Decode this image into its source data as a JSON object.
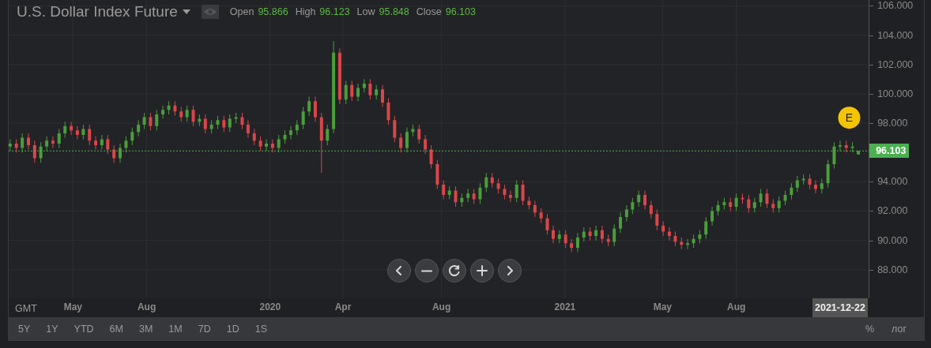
{
  "header": {
    "title": "U.S. Dollar Index Future",
    "ohlc": [
      {
        "label": "Open",
        "value": "95.866"
      },
      {
        "label": "High",
        "value": "96.123"
      },
      {
        "label": "Low",
        "value": "95.848"
      },
      {
        "label": "Close",
        "value": "96.103"
      }
    ]
  },
  "chart_data": {
    "type": "candlestick",
    "xlim": [
      2019.113,
      2022.035
    ],
    "ylim": [
      86.05,
      106.4
    ],
    "yticks": [
      {
        "value": 88,
        "label": "88.000"
      },
      {
        "value": 90,
        "label": "90.000"
      },
      {
        "value": 92,
        "label": "92.000"
      },
      {
        "value": 94,
        "label": "94.000"
      },
      {
        "value": 98,
        "label": "98.000"
      },
      {
        "value": 100,
        "label": "100.000"
      },
      {
        "value": 102,
        "label": "102.000"
      },
      {
        "value": 104,
        "label": "104.000"
      },
      {
        "value": 106,
        "label": "106.000"
      }
    ],
    "xticks": [
      {
        "value": 2019.331,
        "label": "May"
      },
      {
        "value": 2019.581,
        "label": "Aug"
      },
      {
        "value": 2020,
        "label": "2020"
      },
      {
        "value": 2020.247,
        "label": "Apr"
      },
      {
        "value": 2020.581,
        "label": "Aug"
      },
      {
        "value": 2021,
        "label": "2021"
      },
      {
        "value": 2021.331,
        "label": "May"
      },
      {
        "value": 2021.581,
        "label": "Aug"
      }
    ],
    "x": [
      2019.118,
      2019.139,
      2019.159,
      2019.18,
      2019.201,
      2019.222,
      2019.242,
      2019.263,
      2019.284,
      2019.304,
      2019.325,
      2019.346,
      2019.366,
      2019.387,
      2019.408,
      2019.429,
      2019.449,
      2019.47,
      2019.491,
      2019.511,
      2019.532,
      2019.553,
      2019.573,
      2019.594,
      2019.615,
      2019.636,
      2019.656,
      2019.677,
      2019.698,
      2019.718,
      2019.739,
      2019.76,
      2019.78,
      2019.801,
      2019.822,
      2019.843,
      2019.863,
      2019.884,
      2019.905,
      2019.925,
      2019.946,
      2019.967,
      2019.987,
      2020.008,
      2020.029,
      2020.05,
      2020.07,
      2020.091,
      2020.112,
      2020.132,
      2020.153,
      2020.174,
      2020.194,
      2020.215,
      2020.236,
      2020.257,
      2020.277,
      2020.298,
      2020.319,
      2020.339,
      2020.36,
      2020.381,
      2020.401,
      2020.422,
      2020.443,
      2020.464,
      2020.484,
      2020.505,
      2020.526,
      2020.546,
      2020.567,
      2020.588,
      2020.608,
      2020.629,
      2020.65,
      2020.671,
      2020.691,
      2020.712,
      2020.733,
      2020.753,
      2020.774,
      2020.795,
      2020.815,
      2020.836,
      2020.857,
      2020.878,
      2020.898,
      2020.919,
      2020.94,
      2020.96,
      2020.981,
      2021.002,
      2021.022,
      2021.043,
      2021.064,
      2021.085,
      2021.105,
      2021.126,
      2021.147,
      2021.167,
      2021.188,
      2021.209,
      2021.229,
      2021.25,
      2021.271,
      2021.292,
      2021.312,
      2021.333,
      2021.354,
      2021.374,
      2021.395,
      2021.416,
      2021.436,
      2021.457,
      2021.478,
      2021.499,
      2021.519,
      2021.54,
      2021.561,
      2021.581,
      2021.602,
      2021.623,
      2021.643,
      2021.664,
      2021.685,
      2021.706,
      2021.726,
      2021.747,
      2021.768,
      2021.788,
      2021.809,
      2021.83,
      2021.85,
      2021.871,
      2021.892,
      2021.913,
      2021.933,
      2021.954,
      2021.975,
      2021.995
    ],
    "ohlc": [
      [
        96.4,
        96.9,
        96.1,
        96.6
      ],
      [
        96.6,
        96.9,
        96.0,
        96.3
      ],
      [
        96.3,
        97.3,
        96.0,
        97.0
      ],
      [
        97.0,
        97.3,
        96.2,
        96.5
      ],
      [
        96.5,
        96.8,
        95.3,
        95.6
      ],
      [
        95.6,
        96.7,
        95.3,
        96.4
      ],
      [
        96.4,
        97.1,
        96.1,
        96.8
      ],
      [
        96.8,
        97.1,
        96.3,
        96.6
      ],
      [
        96.6,
        97.6,
        96.3,
        97.3
      ],
      [
        97.3,
        98.1,
        97.0,
        97.8
      ],
      [
        97.8,
        98.1,
        97.2,
        97.5
      ],
      [
        97.5,
        97.8,
        96.9,
        97.2
      ],
      [
        97.2,
        97.9,
        96.9,
        97.6
      ],
      [
        97.6,
        97.9,
        96.5,
        96.8
      ],
      [
        96.8,
        97.1,
        96.2,
        96.5
      ],
      [
        96.5,
        97.2,
        96.2,
        96.9
      ],
      [
        96.9,
        97.2,
        95.9,
        96.2
      ],
      [
        96.2,
        96.5,
        95.3,
        95.6
      ],
      [
        95.6,
        96.6,
        95.3,
        96.3
      ],
      [
        96.3,
        97.1,
        96.0,
        96.8
      ],
      [
        96.8,
        97.7,
        96.5,
        97.4
      ],
      [
        97.4,
        98.2,
        97.1,
        97.9
      ],
      [
        97.9,
        98.7,
        97.6,
        98.4
      ],
      [
        98.4,
        98.7,
        97.5,
        97.8
      ],
      [
        97.8,
        98.9,
        97.5,
        98.6
      ],
      [
        98.6,
        99.2,
        98.3,
        98.9
      ],
      [
        98.9,
        99.5,
        98.6,
        99.2
      ],
      [
        99.2,
        99.5,
        98.5,
        98.8
      ],
      [
        98.8,
        99.1,
        98.1,
        98.4
      ],
      [
        98.4,
        99.2,
        98.1,
        98.9
      ],
      [
        98.9,
        99.2,
        97.8,
        98.1
      ],
      [
        98.1,
        98.6,
        97.8,
        98.3
      ],
      [
        98.3,
        98.6,
        97.3,
        97.6
      ],
      [
        97.6,
        98.2,
        97.3,
        97.9
      ],
      [
        97.9,
        98.5,
        97.6,
        98.2
      ],
      [
        98.2,
        98.5,
        97.4,
        97.7
      ],
      [
        97.7,
        98.6,
        97.4,
        98.3
      ],
      [
        98.3,
        98.7,
        98.0,
        98.4
      ],
      [
        98.4,
        98.7,
        97.6,
        97.9
      ],
      [
        97.9,
        98.2,
        97.0,
        97.3
      ],
      [
        97.3,
        97.6,
        96.5,
        96.8
      ],
      [
        96.8,
        97.1,
        96.1,
        96.4
      ],
      [
        96.4,
        96.9,
        96.1,
        96.6
      ],
      [
        96.6,
        96.9,
        96.0,
        96.3
      ],
      [
        96.3,
        97.2,
        96.0,
        96.9
      ],
      [
        96.9,
        97.5,
        96.6,
        97.2
      ],
      [
        97.2,
        97.8,
        96.9,
        97.5
      ],
      [
        97.5,
        98.2,
        97.2,
        97.9
      ],
      [
        97.9,
        99.1,
        97.6,
        98.8
      ],
      [
        98.8,
        99.8,
        98.5,
        99.5
      ],
      [
        99.5,
        99.8,
        98.1,
        98.4
      ],
      [
        98.4,
        98.7,
        94.6,
        96.8
      ],
      [
        96.8,
        97.9,
        96.5,
        97.6
      ],
      [
        97.6,
        103.6,
        97.3,
        102.8
      ],
      [
        102.8,
        103.1,
        99.3,
        99.6
      ],
      [
        99.6,
        100.9,
        99.3,
        100.6
      ],
      [
        100.6,
        100.9,
        99.5,
        99.8
      ],
      [
        99.8,
        100.7,
        99.5,
        100.4
      ],
      [
        100.4,
        101.0,
        100.1,
        100.7
      ],
      [
        100.7,
        101.0,
        99.6,
        99.9
      ],
      [
        99.9,
        100.6,
        99.6,
        100.3
      ],
      [
        100.3,
        100.6,
        99.1,
        99.4
      ],
      [
        99.4,
        99.7,
        97.9,
        98.2
      ],
      [
        98.2,
        98.5,
        96.7,
        97.0
      ],
      [
        97.0,
        97.3,
        96.0,
        96.3
      ],
      [
        96.3,
        97.7,
        96.0,
        97.4
      ],
      [
        97.4,
        97.9,
        97.1,
        97.6
      ],
      [
        97.6,
        97.9,
        96.6,
        96.9
      ],
      [
        96.9,
        97.2,
        95.9,
        96.2
      ],
      [
        96.2,
        96.5,
        94.9,
        95.2
      ],
      [
        95.2,
        95.5,
        93.5,
        93.8
      ],
      [
        93.8,
        94.1,
        92.8,
        93.1
      ],
      [
        93.1,
        93.7,
        92.8,
        93.4
      ],
      [
        93.4,
        93.7,
        92.3,
        92.6
      ],
      [
        92.6,
        93.2,
        92.3,
        92.9
      ],
      [
        92.9,
        93.5,
        92.6,
        93.2
      ],
      [
        93.2,
        93.5,
        92.5,
        92.8
      ],
      [
        92.8,
        93.9,
        92.5,
        93.6
      ],
      [
        93.6,
        94.6,
        93.3,
        94.3
      ],
      [
        94.3,
        94.6,
        93.6,
        93.9
      ],
      [
        93.9,
        94.2,
        93.2,
        93.5
      ],
      [
        93.5,
        93.8,
        92.8,
        93.1
      ],
      [
        93.1,
        93.4,
        92.6,
        92.9
      ],
      [
        92.9,
        94.1,
        92.6,
        93.8
      ],
      [
        93.8,
        94.1,
        92.4,
        92.7
      ],
      [
        92.7,
        93.0,
        92.1,
        92.4
      ],
      [
        92.4,
        92.7,
        91.6,
        91.9
      ],
      [
        91.9,
        92.2,
        91.2,
        91.5
      ],
      [
        91.5,
        91.8,
        90.4,
        90.7
      ],
      [
        90.7,
        91.0,
        89.8,
        90.1
      ],
      [
        90.1,
        90.7,
        89.8,
        90.4
      ],
      [
        90.4,
        90.7,
        89.5,
        89.8
      ],
      [
        89.8,
        90.1,
        89.2,
        89.5
      ],
      [
        89.5,
        90.5,
        89.2,
        90.2
      ],
      [
        90.2,
        90.9,
        89.9,
        90.6
      ],
      [
        90.6,
        90.9,
        90.0,
        90.3
      ],
      [
        90.3,
        91.0,
        90.0,
        90.7
      ],
      [
        90.7,
        91.0,
        89.8,
        90.1
      ],
      [
        90.1,
        90.4,
        89.6,
        89.9
      ],
      [
        89.9,
        91.1,
        89.6,
        90.8
      ],
      [
        90.8,
        91.9,
        90.5,
        91.6
      ],
      [
        91.6,
        92.4,
        91.3,
        92.1
      ],
      [
        92.1,
        92.9,
        91.8,
        92.6
      ],
      [
        92.6,
        93.4,
        92.3,
        93.1
      ],
      [
        93.1,
        93.4,
        92.1,
        92.4
      ],
      [
        92.4,
        92.7,
        91.5,
        91.8
      ],
      [
        91.8,
        92.1,
        90.7,
        91.0
      ],
      [
        91.0,
        91.3,
        90.3,
        90.6
      ],
      [
        90.6,
        90.9,
        90.0,
        90.3
      ],
      [
        90.3,
        90.6,
        89.6,
        89.9
      ],
      [
        89.9,
        90.2,
        89.4,
        89.7
      ],
      [
        89.7,
        90.1,
        89.4,
        89.8
      ],
      [
        89.8,
        90.4,
        89.5,
        90.1
      ],
      [
        90.1,
        90.7,
        89.8,
        90.4
      ],
      [
        90.4,
        91.6,
        90.1,
        91.3
      ],
      [
        91.3,
        92.3,
        91.0,
        92.0
      ],
      [
        92.0,
        92.7,
        91.7,
        92.4
      ],
      [
        92.4,
        92.9,
        92.1,
        92.6
      ],
      [
        92.6,
        92.9,
        92.0,
        92.3
      ],
      [
        92.3,
        93.2,
        92.0,
        92.9
      ],
      [
        92.9,
        93.2,
        92.5,
        92.8
      ],
      [
        92.8,
        93.1,
        91.9,
        92.2
      ],
      [
        92.2,
        92.9,
        91.9,
        92.6
      ],
      [
        92.6,
        93.5,
        92.3,
        93.2
      ],
      [
        93.2,
        93.5,
        92.2,
        92.5
      ],
      [
        92.5,
        92.8,
        91.9,
        92.2
      ],
      [
        92.2,
        93.0,
        91.9,
        92.7
      ],
      [
        92.7,
        93.4,
        92.4,
        93.1
      ],
      [
        93.1,
        93.9,
        92.8,
        93.6
      ],
      [
        93.6,
        94.4,
        93.3,
        94.1
      ],
      [
        94.1,
        94.5,
        93.8,
        94.2
      ],
      [
        94.2,
        94.5,
        93.5,
        93.8
      ],
      [
        93.8,
        94.1,
        93.2,
        93.5
      ],
      [
        93.5,
        94.2,
        93.2,
        93.9
      ],
      [
        93.9,
        95.5,
        93.6,
        95.2
      ],
      [
        95.2,
        96.7,
        94.9,
        96.4
      ],
      [
        96.4,
        96.8,
        96.1,
        96.5
      ],
      [
        96.5,
        96.8,
        96.0,
        96.3
      ],
      [
        96.3,
        96.7,
        96.0,
        96.4
      ],
      [
        95.866,
        96.123,
        95.848,
        96.103
      ]
    ],
    "grid": true,
    "ref_lines": [
      {
        "axis": "y",
        "value": 96.103,
        "label": "96.103",
        "color": "#4caf50"
      }
    ],
    "annotations": [
      {
        "x": 2021.964,
        "y": 98.37,
        "text": "E"
      }
    ]
  },
  "nav_controls": [
    {
      "kind": "prev"
    },
    {
      "kind": "zoom_out"
    },
    {
      "kind": "reset"
    },
    {
      "kind": "zoom_in"
    },
    {
      "kind": "next"
    }
  ],
  "x_axis": {
    "timezone": "GMT",
    "current_date": "2021-12-22"
  },
  "range_buttons": [
    "5Y",
    "1Y",
    "YTD",
    "6M",
    "3M",
    "1M",
    "7D",
    "1D",
    "1S"
  ],
  "scale_options": [
    "%",
    "лог"
  ]
}
